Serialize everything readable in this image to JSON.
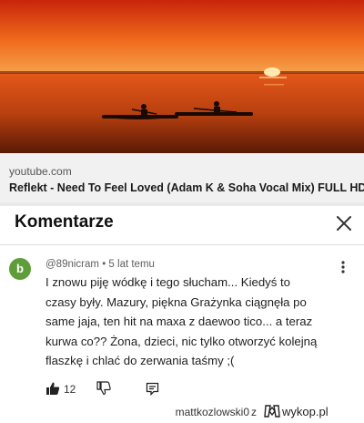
{
  "link_card": {
    "domain": "youtube.com",
    "title": "Reflekt - Need To Feel Loved (Adam K & Soha Vocal Mix) FULL HD"
  },
  "comments_panel": {
    "heading": "Komentarze",
    "close_icon": "close-icon"
  },
  "comment": {
    "avatar_letter": "b",
    "avatar_color": "#5f9c3a",
    "author": "@89nicram",
    "time": "5 lat temu",
    "separator": "•",
    "lines": [
      "I znowu piję wódkę i tego słucham... Kiedyś to",
      "czasy były. Mazury, piękna Grażynka ciągnęła po",
      "same jaja, ten hit na maxa z daewoo tico... a teraz",
      "kurwa co?? Żona, dzieci, nic tylko otworzyć kolejną",
      "flaszkę i chlać do zerwania taśmy ;("
    ],
    "likes": "12",
    "icons": [
      "thumbs-up-icon",
      "thumbs-down-icon",
      "reply-icon",
      "more-vertical-icon"
    ]
  },
  "watermark": {
    "author": "mattkozlowski0",
    "conjunction": "z",
    "site": "wykop.pl"
  }
}
